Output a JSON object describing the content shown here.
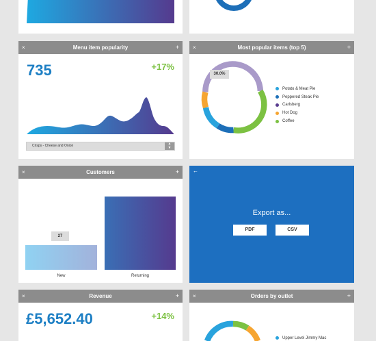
{
  "colors": {
    "accent_blue": "#1d7fc4",
    "accent_green": "#7cc142",
    "header_gray": "#8c8c8c",
    "export_bg": "#1d6fc0",
    "gradient_start": "#1ea9e1",
    "gradient_end": "#553a8e"
  },
  "cards": {
    "menu_popularity": {
      "title": "Menu item popularity",
      "value": "735",
      "change": "+17%",
      "dropdown_value": "Crisps - Cheese and Onion",
      "close_icon": "×",
      "add_icon": "+"
    },
    "popular_items": {
      "title": "Most popular items (top 5)",
      "tooltip": "30.0%",
      "close_icon": "×",
      "add_icon": "+",
      "legend": [
        {
          "label": "Potato & Meat Pie",
          "color": "#29a3dd"
        },
        {
          "label": "Peppered Steak Pie",
          "color": "#1d6fb8"
        },
        {
          "label": "Carlsberg",
          "color": "#5a3d8f"
        },
        {
          "label": "Hot Dog",
          "color": "#f6a531"
        },
        {
          "label": "Coffee",
          "color": "#7cc142"
        }
      ]
    },
    "customers": {
      "title": "Customers",
      "tooltip": "27",
      "close_icon": "×",
      "add_icon": "+",
      "bars": [
        {
          "label": "New",
          "value": 27
        },
        {
          "label": "Returning",
          "value": 73
        }
      ]
    },
    "export": {
      "back_icon": "←",
      "title": "Export as...",
      "pdf_label": "PDF",
      "csv_label": "CSV"
    },
    "revenue": {
      "title": "Revenue",
      "value": "£5,652.40",
      "change": "+14%",
      "close_icon": "×",
      "add_icon": "+"
    },
    "orders_outlet": {
      "title": "Orders by outlet",
      "close_icon": "×",
      "add_icon": "+",
      "legend": [
        {
          "label": "Upper Level Jimmy Mac",
          "color": "#29a3dd"
        }
      ]
    }
  }
}
